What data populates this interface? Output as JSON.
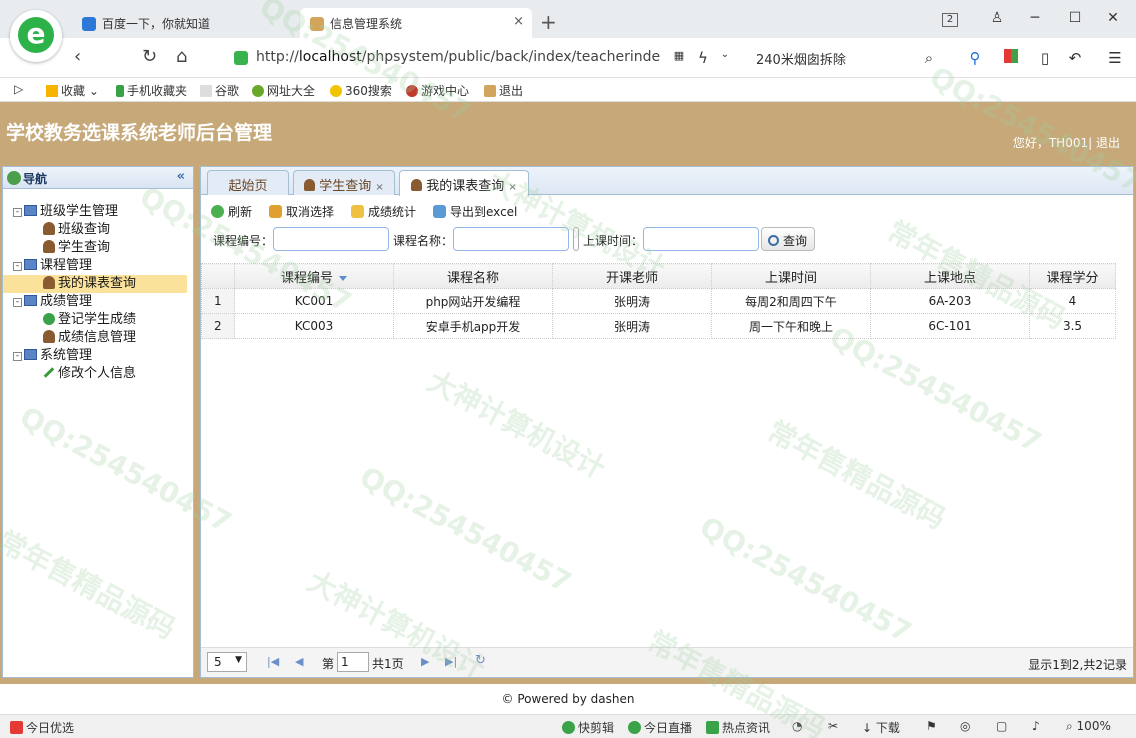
{
  "browser": {
    "tabs": [
      {
        "label": "百度一下，你就知道"
      },
      {
        "label": "信息管理系统"
      }
    ],
    "new_tab": "+",
    "tab_count": "2",
    "url_prefix": "http://",
    "url_host": "localhost",
    "url_path": "/phpsystem/public/back/index/teacherinde",
    "search_hint": "240米烟囱拆除",
    "bookmarks": [
      "收藏",
      "手机收藏夹",
      "谷歌",
      "网址大全",
      "360搜索",
      "游戏中心",
      "退出"
    ],
    "status": {
      "left": "今日优选",
      "items": [
        "快剪辑",
        "今日直播",
        "热点资讯",
        "下载"
      ],
      "zoom": "100%"
    }
  },
  "app": {
    "title": "学校教务选课系统老师后台管理",
    "greeting": "您好，TH001|",
    "logout": "退出",
    "footer": "© Powered by dashen"
  },
  "sidebar": {
    "title": "导航",
    "collapse": "«",
    "groups": [
      {
        "label": "班级学生管理",
        "toggle": "-",
        "items": [
          "班级查询",
          "学生查询"
        ]
      },
      {
        "label": "课程管理",
        "toggle": "-",
        "items": [
          "我的课表查询"
        ]
      },
      {
        "label": "成绩管理",
        "toggle": "-",
        "items": [
          "登记学生成绩",
          "成绩信息管理"
        ]
      },
      {
        "label": "系统管理",
        "toggle": "-",
        "items": [
          "修改个人信息"
        ]
      }
    ]
  },
  "tabs": [
    {
      "label": "起始页",
      "close": ""
    },
    {
      "label": "学生查询",
      "close": "×"
    },
    {
      "label": "我的课表查询",
      "close": "×"
    }
  ],
  "toolbar": {
    "refresh": "刷新",
    "deselect": "取消选择",
    "stats": "成绩统计",
    "export": "导出到excel"
  },
  "search": {
    "code_label": "课程编号：",
    "name_label": "课程名称：",
    "time_label": "上课时间：",
    "button": "查询"
  },
  "grid": {
    "columns": [
      "课程编号",
      "课程名称",
      "开课老师",
      "上课时间",
      "上课地点",
      "课程学分"
    ],
    "rows": [
      {
        "n": "1",
        "cells": [
          "KC001",
          "php网站开发编程",
          "张明涛",
          "每周2和周四下午",
          "6A-203",
          "4"
        ]
      },
      {
        "n": "2",
        "cells": [
          "KC003",
          "安卓手机app开发",
          "张明涛",
          "周一下午和晚上",
          "6C-101",
          "3.5"
        ]
      }
    ]
  },
  "pager": {
    "page_size": "5",
    "page_prefix": "第",
    "page_value": "1",
    "page_suffix": "共1页",
    "info": "显示1到2,共2记录"
  },
  "watermarks": [
    "QQ:254540457",
    "大神计算机设计",
    "常年售精品源码"
  ]
}
